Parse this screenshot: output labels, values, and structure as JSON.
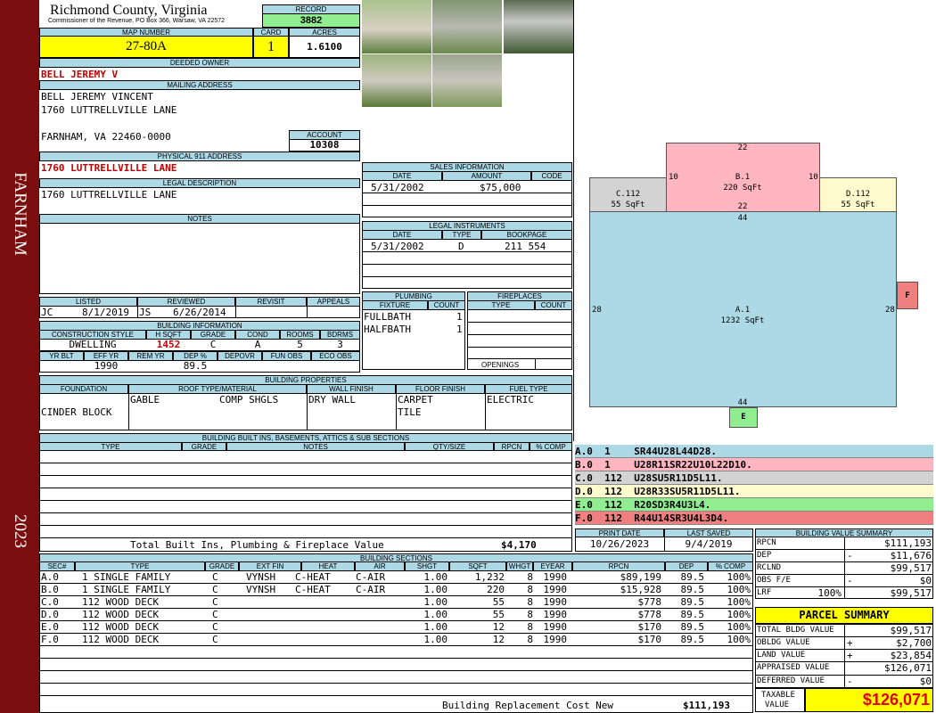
{
  "header": {
    "county": "Richmond County, Virginia",
    "address": "Commissioner of the Revenue, PO Box 366, Warsaw, VA 22572",
    "record_label": "RECORD",
    "record": "3882",
    "map_label": "MAP NUMBER",
    "map_number": "27-80A",
    "card_label": "CARD",
    "card": "1",
    "acres_label": "ACRES",
    "acres": "1.6100"
  },
  "side": {
    "district": "FARNHAM",
    "year": "2023"
  },
  "owner": {
    "deeded_label": "DEEDED OWNER",
    "deeded": "BELL JEREMY V",
    "mailing_label": "MAILING ADDRESS",
    "mail1": "BELL JEREMY VINCENT",
    "mail2": "1760 LUTTRELLVILLE LANE",
    "mail3": "FARNHAM, VA 22460-0000",
    "account_label": "ACCOUNT",
    "account": "10308",
    "phys_label": "PHYSICAL 911 ADDRESS",
    "phys": "1760 LUTTRELLVILLE LANE",
    "legal_label": "LEGAL DESCRIPTION",
    "legal": "1760 LUTTRELLVILLE LANE",
    "notes_label": "NOTES"
  },
  "sales": {
    "label": "SALES INFORMATION",
    "h": [
      "DATE",
      "AMOUNT",
      "CODE"
    ],
    "date": "5/31/2002",
    "amount": "$75,000"
  },
  "instr": {
    "label": "LEGAL INSTRUMENTS",
    "h": [
      "DATE",
      "TYPE",
      "BOOKPAGE"
    ],
    "date": "5/31/2002",
    "type": "D",
    "book": "211 554"
  },
  "listed": {
    "h": [
      "LISTED",
      "REVIEWED",
      "REVISIT",
      "APPEALS"
    ],
    "lby": "JC",
    "ldate": "8/1/2019",
    "rby": "JS",
    "rdate": "6/26/2014"
  },
  "bldg": {
    "label": "BUILDING INFORMATION",
    "h": [
      "CONSTRUCTION STYLE",
      "H SQFT",
      "GRADE",
      "COND",
      "ROOMS",
      "BDRMS"
    ],
    "style": "DWELLING",
    "sqft": "1452",
    "grade": "C",
    "cond": "A",
    "rooms": "5",
    "bdrms": "3",
    "h2": [
      "YR BLT",
      "EFF YR",
      "REM YR",
      "DEP %",
      "DEPOVR",
      "FUN OBS",
      "ECO OBS"
    ],
    "effyr": "1990",
    "dep": "89.5"
  },
  "plumb": {
    "label": "PLUMBING",
    "h": [
      "FIXTURE",
      "COUNT"
    ],
    "f1": "FULLBATH",
    "c1": "1",
    "f2": "HALFBATH",
    "c2": "1"
  },
  "fire": {
    "label": "FIREPLACES",
    "h": [
      "TYPE",
      "COUNT"
    ],
    "open": "OPENINGS"
  },
  "props": {
    "label": "BUILDING PROPERTIES",
    "h": [
      "FOUNDATION",
      "ROOF TYPE/MATERIAL",
      "WALL FINISH",
      "FLOOR FINISH",
      "FUEL TYPE"
    ],
    "foundation": "CINDER BLOCK",
    "roof_type": "GABLE",
    "roof_mat": "COMP SHGLS",
    "wall": "DRY WALL",
    "floor1": "CARPET",
    "floor2": "TILE",
    "fuel": "ELECTRIC"
  },
  "builtins": {
    "label": "BUILDING BUILT INS, BASEMENTS, ATTICS & SUB SECTIONS",
    "h": [
      "TYPE",
      "GRADE",
      "NOTES",
      "QTY/SIZE",
      "RPCN",
      "% COMP"
    ],
    "total_label": "Total Built Ins, Plumbing & Fireplace Value",
    "total": "$4,170"
  },
  "print": {
    "h": [
      "PRINT DATE",
      "LAST SAVED"
    ],
    "print": "10/26/2023",
    "saved": "9/4/2019"
  },
  "sections": {
    "label": "BUILDING SECTIONS",
    "h": [
      "SEC#",
      "TYPE",
      "GRADE",
      "EXT FIN",
      "HEAT",
      "AIR",
      "SHGT",
      "SQFT",
      "WHGT",
      "EYEAR",
      "RPCN",
      "DEP",
      "% COMP"
    ],
    "rows": [
      [
        "A.0",
        "1 SINGLE FAMILY",
        "C",
        "VYNSH",
        "C-HEAT",
        "C-AIR",
        "1.00",
        "1,232",
        "8",
        "1990",
        "$89,199",
        "89.5",
        "100%"
      ],
      [
        "B.0",
        "1 SINGLE FAMILY",
        "C",
        "VYNSH",
        "C-HEAT",
        "C-AIR",
        "1.00",
        "220",
        "8",
        "1990",
        "$15,928",
        "89.5",
        "100%"
      ],
      [
        "C.0",
        "112 WOOD DECK",
        "C",
        "",
        "",
        "",
        "1.00",
        "55",
        "8",
        "1990",
        "$778",
        "89.5",
        "100%"
      ],
      [
        "D.0",
        "112 WOOD DECK",
        "C",
        "",
        "",
        "",
        "1.00",
        "55",
        "8",
        "1990",
        "$778",
        "89.5",
        "100%"
      ],
      [
        "E.0",
        "112 WOOD DECK",
        "C",
        "",
        "",
        "",
        "1.00",
        "12",
        "8",
        "1990",
        "$170",
        "89.5",
        "100%"
      ],
      [
        "F.0",
        "112 WOOD DECK",
        "C",
        "",
        "",
        "",
        "1.00",
        "12",
        "8",
        "1990",
        "$170",
        "89.5",
        "100%"
      ]
    ],
    "cost_label": "Building Replacement Cost New",
    "cost": "$111,193"
  },
  "sketch": {
    "b_t": "22",
    "b_l": "10",
    "b_r": "10",
    "b_b": "22",
    "b_name": "B.1",
    "b_area": "220 SqFt",
    "c_name": "C.112",
    "c_area": "55 SqFt",
    "d_name": "D.112",
    "d_area": "55 SqFt",
    "a_top": "44",
    "a_l": "28",
    "a_r": "28",
    "a_name": "A.1",
    "a_area": "1232 SqFt",
    "a_bot": "44",
    "e": "E",
    "f": "F",
    "colors": {
      "a": "#add8e6",
      "b": "#ffb6c1",
      "c": "#d3d3d3",
      "d": "#fffacd",
      "e": "#90ee90",
      "f": "#f08080"
    }
  },
  "segs": [
    {
      "id": "A.0",
      "code": "1",
      "path": "SR44U28L44D28.",
      "color": "#add8e6"
    },
    {
      "id": "B.0",
      "code": "1",
      "path": "U28R11SR22U10L22D10.",
      "color": "#ffb6c1"
    },
    {
      "id": "C.0",
      "code": "112",
      "path": "U28SU5R11D5L11.",
      "color": "#d3d3d3"
    },
    {
      "id": "D.0",
      "code": "112",
      "path": "U28R33SU5R11D5L11.",
      "color": "#fffacd"
    },
    {
      "id": "E.0",
      "code": "112",
      "path": "R20SD3R4U3L4.",
      "color": "#90ee90"
    },
    {
      "id": "F.0",
      "code": "112",
      "path": "R44U14SR3U4L3D4.",
      "color": "#f08080"
    }
  ],
  "bvs": {
    "label": "BUILDING VALUE SUMMARY",
    "rpcn_l": "RPCN",
    "rpcn": "$111,193",
    "dep_l": "DEP",
    "dep_s": "-",
    "dep": "$11,676",
    "rcl_l": "RCLND",
    "rcl": "$99,517",
    "obs_l": "OBS F/E",
    "obs_s": "-",
    "obs": "$0",
    "lrf_l": "LRF",
    "lrf_p": "100%",
    "lrf": "$99,517"
  },
  "ps": {
    "label": "PARCEL SUMMARY",
    "tb_l": "TOTAL BLDG VALUE",
    "tb": "$99,517",
    "ob_l": "OBLDG VALUE",
    "ob_s": "+",
    "ob": "$2,700",
    "lv_l": "LAND VALUE",
    "lv_s": "+",
    "lv": "$23,854",
    "ap_l": "APPRAISED VALUE",
    "ap": "$126,071",
    "df_l": "DEFERRED VALUE",
    "df_s": "-",
    "df": "$0",
    "tx_l1": "TAXABLE",
    "tx_l2": "VALUE",
    "tx": "$126,071"
  }
}
